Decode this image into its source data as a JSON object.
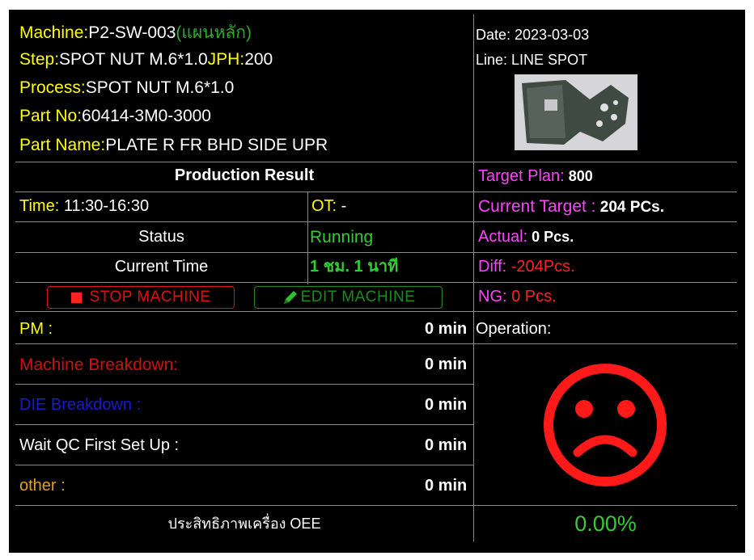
{
  "header": {
    "machine_label": "Machine:",
    "machine_value": "P2-SW-003",
    "machine_note": "(แผนหลัก)",
    "step_label": "Step:",
    "step_value": "SPOT NUT M.6*1.0",
    "jph_label": "JPH:",
    "jph_value": "200",
    "process_label": "Process:",
    "process_value": "SPOT NUT M.6*1.0",
    "part_no_label": "Part No:",
    "part_no_value": "60414-3M0-3000",
    "part_name_label": "Part Name:",
    "part_name_value": "PLATE R FR BHD SIDE UPR",
    "date": "Date: 2023-03-03",
    "line": "Line: LINE SPOT"
  },
  "result": {
    "title": "Production Result",
    "time_label": "Time:",
    "time_value": " 11:30-16:30",
    "ot_label": "OT:",
    "ot_value": " -",
    "status_label": "Status",
    "status_value": "Running",
    "current_time_label": "Current Time",
    "current_time_value": "1 ชม. 1 นาที"
  },
  "buttons": {
    "stop": "STOP MACHINE",
    "edit": "EDIT MACHINE"
  },
  "targets": {
    "plan_label": "Target Plan:",
    "plan_value": " 800",
    "current_label": "Current Target :",
    "current_value": " 204 PCs.",
    "actual_label": "Actual:",
    "actual_value": " 0 Pcs.",
    "diff_label": "Diff:",
    "diff_value": " -204Pcs.",
    "ng_label": "NG:",
    "ng_value": " 0 Pcs."
  },
  "downtime": {
    "pm_label": "PM :",
    "pm_value": "0 min",
    "breakdown_label": "Machine Breakdown:",
    "breakdown_value": "0 min",
    "die_label": "DIE Breakdown :",
    "die_value": "0 min",
    "qc_label": "Wait QC First Set Up :",
    "qc_value": "0 min",
    "other_label": "other :",
    "other_value": "0 min"
  },
  "operation": {
    "label": "Operation:",
    "face_color": "#ff1a1a"
  },
  "oee": {
    "label": "ประสิทธิภาพเครื่อง OEE",
    "value": "0.00%"
  },
  "colors": {
    "background": "#000000",
    "label_yellow": "#ffff00",
    "magenta": "#ff44ff",
    "red": "#ff2222",
    "green": "#33cc33"
  }
}
